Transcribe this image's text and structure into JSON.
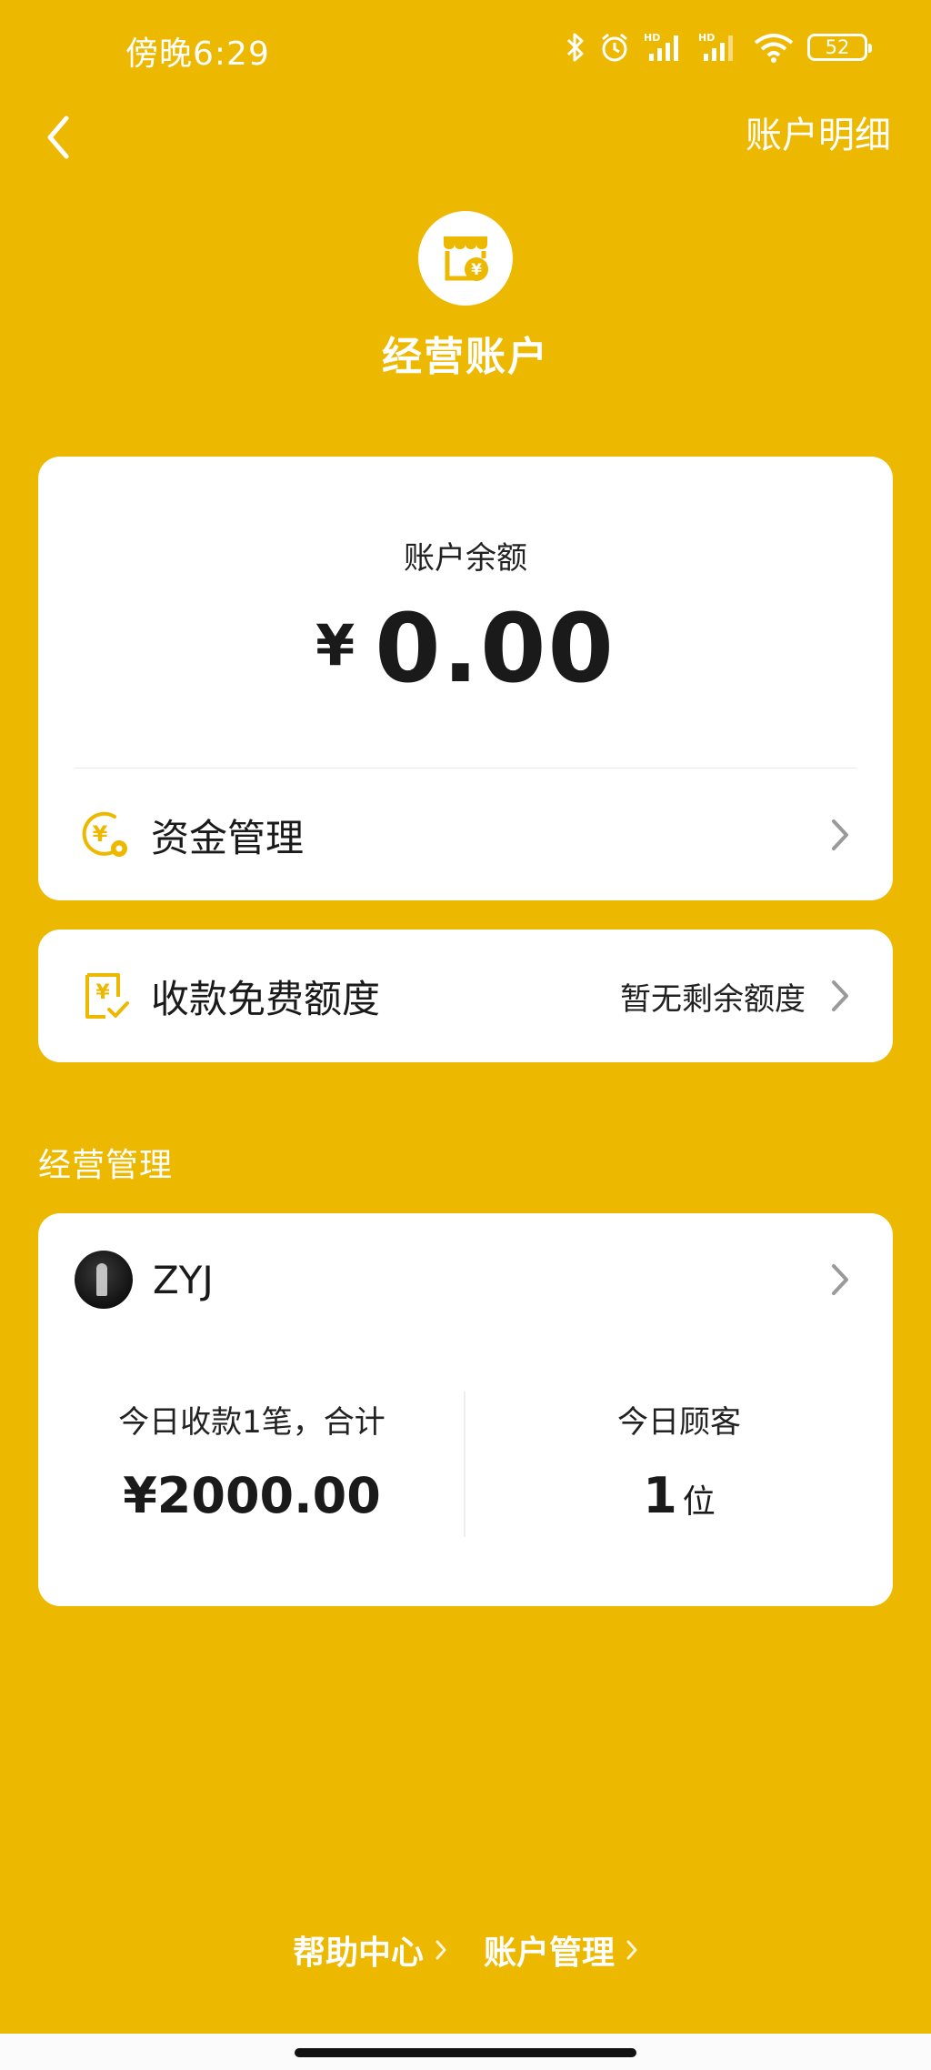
{
  "status_bar": {
    "time": "傍晚6:29",
    "battery": "52",
    "icons": [
      "bluetooth-icon",
      "alarm-icon",
      "signal-hd-icon",
      "signal-hd-icon",
      "wifi-icon",
      "battery-icon"
    ]
  },
  "nav": {
    "detail_label": "账户明细"
  },
  "header": {
    "title": "经营账户"
  },
  "balance_card": {
    "label": "账户余额",
    "currency": "¥",
    "amount": "0.00",
    "fund_management_label": "资金管理"
  },
  "quota_card": {
    "label": "收款免费额度",
    "value": "暂无剩余额度"
  },
  "section": {
    "title": "经营管理"
  },
  "shop_card": {
    "name": "ZYJ",
    "today_receipts_label": "今日收款1笔，合计",
    "today_receipts_value": "¥2000.00",
    "today_customers_label": "今日顾客",
    "today_customers_value": "1",
    "today_customers_unit": "位"
  },
  "footer": {
    "help_label": "帮助中心",
    "account_mgmt_label": "账户管理"
  },
  "colors": {
    "background": "#EDB800",
    "card": "#FFFFFF",
    "accent": "#EDB800"
  }
}
